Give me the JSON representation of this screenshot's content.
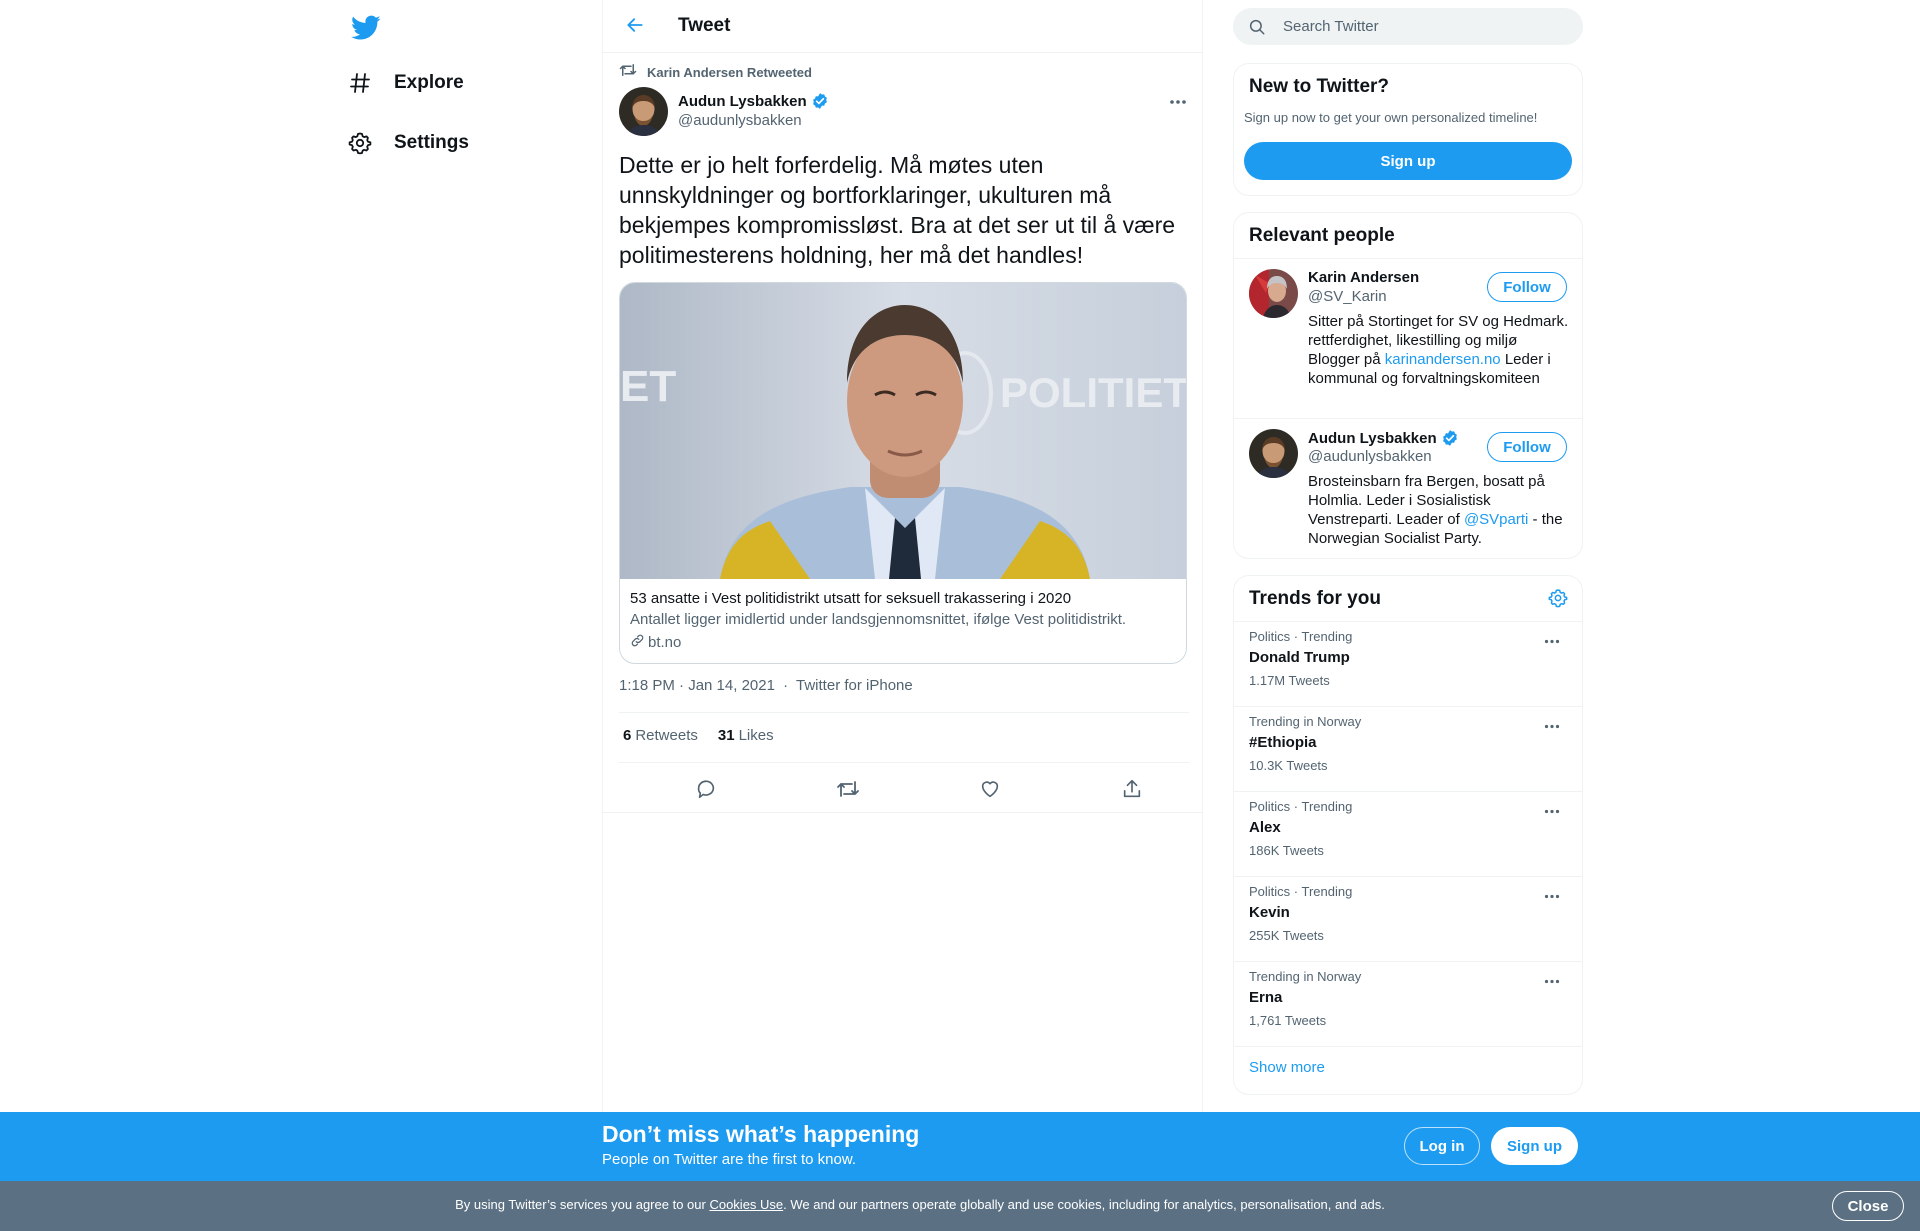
{
  "nav": {
    "logo_icon": "twitter-bird-icon",
    "items": [
      {
        "label": "Explore",
        "icon": "hashtag-icon"
      },
      {
        "label": "Settings",
        "icon": "gear-icon"
      }
    ]
  },
  "header": {
    "title": "Tweet",
    "back_icon": "arrow-left-icon"
  },
  "tweet": {
    "retweeted_by": "Karin Andersen Retweeted",
    "author_name": "Audun Lysbakken",
    "author_handle": "@audunlysbakken",
    "verified": true,
    "text": "Dette er jo helt forferdelig. Må møtes uten unnskyldninger og bortforklaringer, ukulturen må bekjempes kompromissløst. Bra at det ser ut til å være politimesterens holdning, her må det handles!",
    "card": {
      "title": "53 ansatte i Vest politidistrikt utsatt for seksuell trakassering i 2020",
      "description": "Antallet ligger imidlertid under landsgjennomsnittet, ifølge Vest politidistrikt.",
      "domain": "bt.no",
      "image_text": "POLITIET",
      "image_text_left": "ET"
    },
    "time": "1:18 PM · Jan 14, 2021",
    "separator": "·",
    "source": "Twitter for iPhone",
    "retweets": "6",
    "retweets_label": "Retweets",
    "likes": "31",
    "likes_label": "Likes"
  },
  "search": {
    "placeholder": "Search Twitter"
  },
  "new_to_twitter": {
    "title": "New to Twitter?",
    "subtitle": "Sign up now to get your own personalized timeline!",
    "button": "Sign up"
  },
  "relevant_people": {
    "title": "Relevant people",
    "follow_label": "Follow",
    "people": [
      {
        "name": "Karin Andersen",
        "handle": "@SV_Karin",
        "bio_before": "Sitter på Stortinget for SV og Hedmark. rettferdighet, likestilling og miljø Blogger på ",
        "bio_link": "karinandersen.no",
        "bio_after": " Leder i kommunal og forvaltningskomiteen"
      },
      {
        "name": "Audun Lysbakken",
        "handle": "@audunlysbakken",
        "verified": true,
        "bio_before": "Brosteinsbarn fra Bergen, bosatt på Holmlia. Leder i Sosialistisk Venstreparti. Leader of ",
        "bio_link": "@SVparti",
        "bio_after": " - the Norwegian Socialist Party."
      }
    ]
  },
  "trends": {
    "title": "Trends for you",
    "items": [
      {
        "category": "Politics · Trending",
        "name": "Donald Trump",
        "count": "1.17M Tweets"
      },
      {
        "category": "Trending in Norway",
        "name": "#Ethiopia",
        "count": "10.3K Tweets"
      },
      {
        "category": "Politics · Trending",
        "name": "Alex",
        "count": "186K Tweets"
      },
      {
        "category": "Politics · Trending",
        "name": "Kevin",
        "count": "255K Tweets"
      },
      {
        "category": "Trending in Norway",
        "name": "Erna",
        "count": "1,761 Tweets"
      }
    ],
    "show_more": "Show more"
  },
  "banner": {
    "title": "Don’t miss what’s happening",
    "subtitle": "People on Twitter are the first to know.",
    "login": "Log in",
    "signup": "Sign up"
  },
  "cookie": {
    "text_before": "By using Twitter’s services you agree to our ",
    "link": "Cookies Use",
    "text_after": ". We and our partners operate globally and use cookies, including for analytics, personalisation, and ads.",
    "close": "Close"
  },
  "colors": {
    "accent": "#1d9bf0",
    "text": "#0f1419",
    "secondary": "#536471",
    "cookie_bar": "#5b7083"
  }
}
